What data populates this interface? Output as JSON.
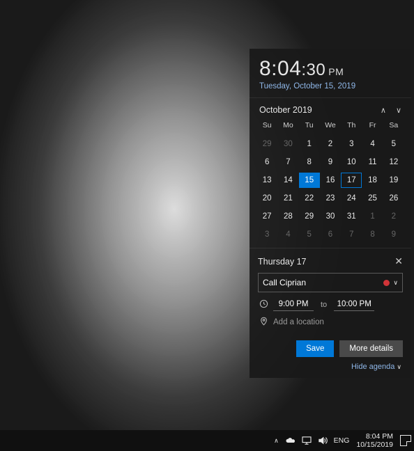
{
  "clock": {
    "time_main": "8:04",
    "time_sec": ":30",
    "period": "PM",
    "date_string": "Tuesday, October 15, 2019"
  },
  "calendar": {
    "month_label": "October 2019",
    "dow": [
      "Su",
      "Mo",
      "Tu",
      "We",
      "Th",
      "Fr",
      "Sa"
    ],
    "weeks": [
      [
        {
          "n": 29,
          "dim": true
        },
        {
          "n": 30,
          "dim": true
        },
        {
          "n": 1
        },
        {
          "n": 2
        },
        {
          "n": 3
        },
        {
          "n": 4
        },
        {
          "n": 5
        }
      ],
      [
        {
          "n": 6
        },
        {
          "n": 7
        },
        {
          "n": 8
        },
        {
          "n": 9
        },
        {
          "n": 10
        },
        {
          "n": 11
        },
        {
          "n": 12
        }
      ],
      [
        {
          "n": 13
        },
        {
          "n": 14
        },
        {
          "n": 15,
          "today": true
        },
        {
          "n": 16
        },
        {
          "n": 17,
          "sel": true
        },
        {
          "n": 18
        },
        {
          "n": 19
        }
      ],
      [
        {
          "n": 20
        },
        {
          "n": 21
        },
        {
          "n": 22
        },
        {
          "n": 23
        },
        {
          "n": 24
        },
        {
          "n": 25
        },
        {
          "n": 26
        }
      ],
      [
        {
          "n": 27
        },
        {
          "n": 28
        },
        {
          "n": 29
        },
        {
          "n": 30
        },
        {
          "n": 31
        },
        {
          "n": 1,
          "dim": true
        },
        {
          "n": 2,
          "dim": true
        }
      ],
      [
        {
          "n": 3,
          "dim": true
        },
        {
          "n": 4,
          "dim": true
        },
        {
          "n": 5,
          "dim": true
        },
        {
          "n": 6,
          "dim": true
        },
        {
          "n": 7,
          "dim": true
        },
        {
          "n": 8,
          "dim": true
        },
        {
          "n": 9,
          "dim": true
        }
      ]
    ]
  },
  "agenda": {
    "day_label": "Thursday 17",
    "event_title": "Call Ciprian",
    "calendar_color": "#d13438",
    "start_time": "9:00 PM",
    "time_to": "to",
    "end_time": "10:00 PM",
    "location_placeholder": "Add a location",
    "save_label": "Save",
    "more_label": "More details",
    "hide_label": "Hide agenda"
  },
  "taskbar": {
    "lang": "ENG",
    "time": "8:04 PM",
    "date": "10/15/2019"
  }
}
